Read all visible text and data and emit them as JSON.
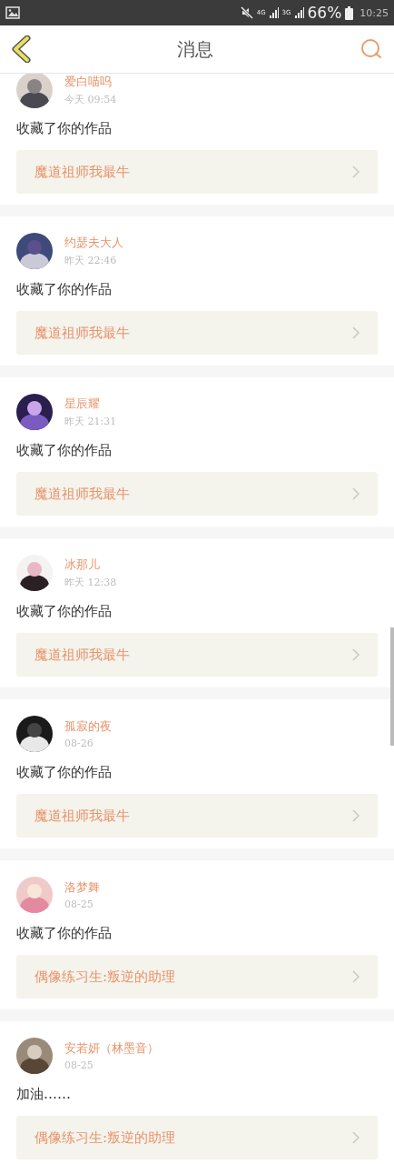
{
  "status_bar": {
    "network": "4G",
    "network_2": "3G",
    "battery": "66%",
    "time": "10:25"
  },
  "header": {
    "title": "消息"
  },
  "messages": [
    {
      "user": "爱白喵呜",
      "time": "今天 09:54",
      "text": "收藏了你的作品",
      "work": "魔道祖师我最牛"
    },
    {
      "user": "约瑟夫大人",
      "time": "昨天 22:46",
      "text": "收藏了你的作品",
      "work": "魔道祖师我最牛"
    },
    {
      "user": "星辰耀",
      "time": "昨天 21:31",
      "text": "收藏了你的作品",
      "work": "魔道祖师我最牛"
    },
    {
      "user": "冰那儿",
      "time": "昨天 12:38",
      "text": "收藏了你的作品",
      "work": "魔道祖师我最牛"
    },
    {
      "user": "孤寂的夜",
      "time": "08-26",
      "text": "收藏了你的作品",
      "work": "魔道祖师我最牛"
    },
    {
      "user": "洛梦舞",
      "time": "08-25",
      "text": "收藏了你的作品",
      "work": "偶像练习生:叛逆的助理"
    },
    {
      "user": "安若妍（林墨音）",
      "time": "08-25",
      "text": "加油……",
      "work": "偶像练习生:叛逆的助理"
    }
  ]
}
